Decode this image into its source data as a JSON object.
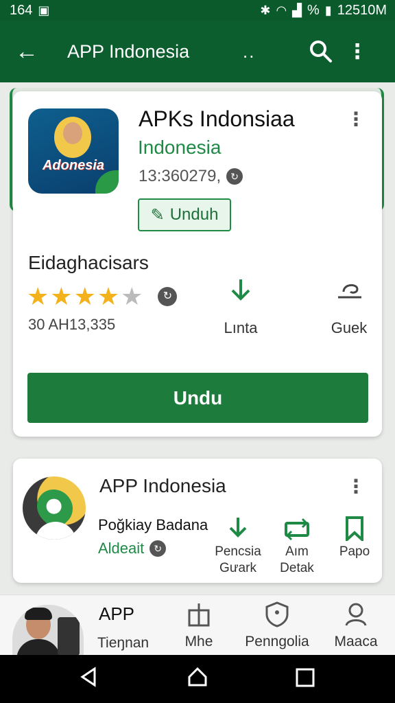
{
  "status_bar": {
    "time_left": "164",
    "percent": "%",
    "time_right": "12510M"
  },
  "toolbar": {
    "title": "APP Indonesia",
    "dots": ".."
  },
  "app_card": {
    "icon_word": "Adonesia",
    "name": "APKs Indonsiaa",
    "subtitle": "Indonesia",
    "count": "13:360279,",
    "small_button": "Unduh",
    "section_label": "Eidaghacisars",
    "rating": 4,
    "rating_max": 5,
    "rating_count": "30 AH13,335",
    "stat_download_label": "Lınta",
    "stat_share_label": "Guek",
    "big_button": "Undu"
  },
  "second_card": {
    "title": "APP Indonesia",
    "name": "Poğkiay Badana",
    "sub": "Aldeait",
    "actions": [
      {
        "line1": "Pencsia",
        "line2": "Gưark"
      },
      {
        "line1": "Aım",
        "line2": "Detak"
      },
      {
        "line1": "",
        "line2": "Papo"
      }
    ]
  },
  "bottom_nav": {
    "first_title": "APP",
    "first_label": "Tieŋnan",
    "items": [
      "Mhe",
      "Penngolia",
      "Maaca"
    ]
  },
  "colors": {
    "accent": "#1f8a45",
    "toolbar": "#0d5e2f",
    "star": "#f3b21b"
  }
}
